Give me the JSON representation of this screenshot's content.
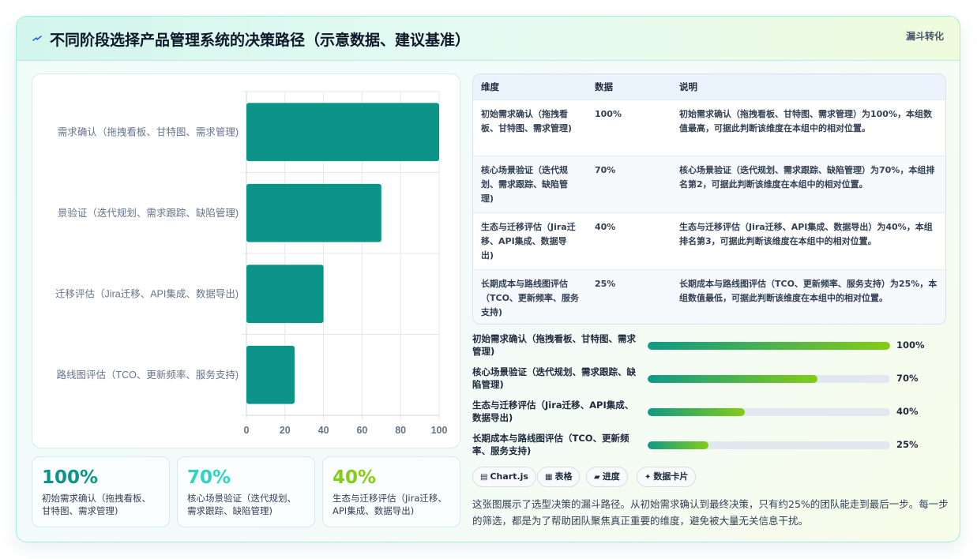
{
  "header": {
    "title": "不同阶段选择产品管理系统的决策路径（示意数据、建议基准）",
    "tag": "漏斗转化",
    "icon": "zap-icon"
  },
  "chart_data": {
    "type": "bar",
    "orientation": "horizontal",
    "categories": [
      "需求确认（拖拽看板、甘特图、需求管理)",
      "景验证（迭代规划、需求跟踪、缺陷管理)",
      "迁移评估（Jira迁移、API集成、数据导出)",
      "路线图评估（TCO、更新频率、服务支持)"
    ],
    "values": [
      100,
      70,
      40,
      25
    ],
    "xlim": [
      0,
      100
    ],
    "xticks": [
      "0",
      "20",
      "40",
      "60",
      "80",
      "100"
    ],
    "grid": true,
    "bar_color": "#0d9488"
  },
  "kpis": [
    {
      "value": "100%",
      "label": "初始需求确认（拖拽看板、甘特图、需求管理)",
      "color": "#0d9488"
    },
    {
      "value": "70%",
      "label": "核心场景验证（迭代规划、需求跟踪、缺陷管理)",
      "color": "#2dd4bf"
    },
    {
      "value": "40%",
      "label": "生态与迁移评估（Jira迁移、API集成、数据导出)",
      "color": "#84cc16"
    }
  ],
  "table": {
    "headers": [
      "维度",
      "数据",
      "说明"
    ],
    "rows": [
      {
        "dim": "初始需求确认（拖拽看板、甘特图、需求管理)",
        "val": "100%",
        "desc": "初始需求确认（拖拽看板、甘特图、需求管理）为100%，本组数值最高，可据此判断该维度在本组中的相对位置。"
      },
      {
        "dim": "核心场景验证（迭代规划、需求跟踪、缺陷管理)",
        "val": "70%",
        "desc": "核心场景验证（迭代规划、需求跟踪、缺陷管理）为70%，本组排名第2，可据此判断该维度在本组中的相对位置。"
      },
      {
        "dim": "生态与迁移评估（Jira迁移、API集成、数据导出)",
        "val": "40%",
        "desc": "生态与迁移评估（Jira迁移、API集成、数据导出）为40%，本组排名第3，可据此判断该维度在本组中的相对位置。"
      },
      {
        "dim": "长期成本与路线图评估（TCO、更新频率、服务支持)",
        "val": "25%",
        "desc": "长期成本与路线图评估（TCO、更新频率、服务支持）为25%，本组数值最低，可据此判断该维度在本组中的相对位置。"
      }
    ]
  },
  "progress": [
    {
      "label": "初始需求确认（拖拽看板、甘特图、需求管理)",
      "value": 100,
      "text": "100%"
    },
    {
      "label": "核心场景验证（迭代规划、需求跟踪、缺陷管理)",
      "value": 70,
      "text": "70%"
    },
    {
      "label": "生态与迁移评估（Jira迁移、API集成、数据导出)",
      "value": 40,
      "text": "40%"
    },
    {
      "label": "长期成本与路线图评估（TCO、更新频率、服务支持)",
      "value": 25,
      "text": "25%"
    }
  ],
  "buttons": [
    {
      "icon": "chart-icon",
      "glyph": "▤",
      "label": "Chart.js"
    },
    {
      "icon": "table-icon",
      "glyph": "▦",
      "label": "表格"
    },
    {
      "icon": "progress-icon",
      "glyph": "▰",
      "label": "进度"
    },
    {
      "icon": "sparkle-icon",
      "glyph": "✦",
      "label": "数据卡片"
    }
  ],
  "summary": "这张图展示了选型决策的漏斗路径。从初始需求确认到最终决策，只有约25%的团队能走到最后一步。每一步的筛选，都是为了帮助团队聚焦真正重要的维度，避免被大量无关信息干扰。"
}
